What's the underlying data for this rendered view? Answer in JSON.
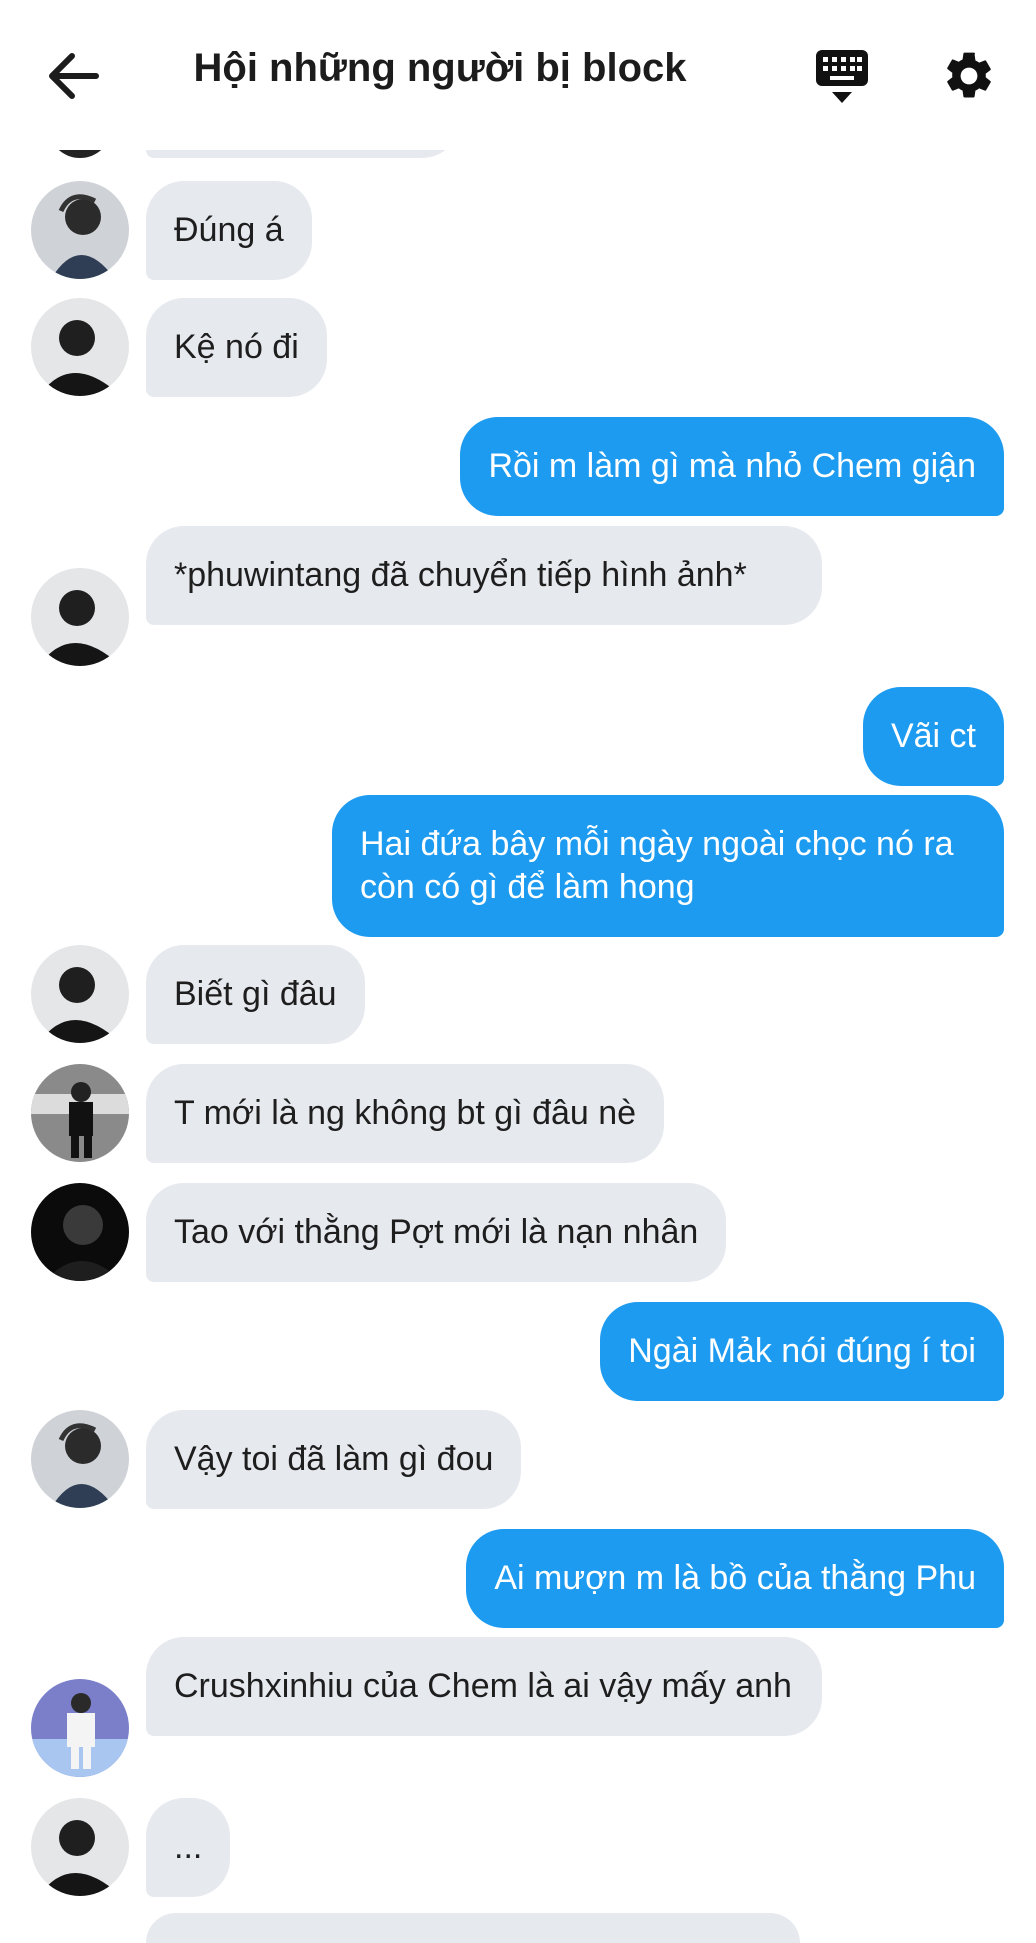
{
  "header": {
    "title": "Hội những người bị block",
    "back_icon": "arrow-left-icon",
    "keyboard_icon": "keyboard-icon",
    "settings_icon": "gear-icon"
  },
  "colors": {
    "outgoing_bubble": "#1d9bf0",
    "incoming_bubble": "#e6e9ee",
    "background": "#ffffff"
  },
  "messages": [
    {
      "side": "in",
      "text": "Đúng á"
    },
    {
      "side": "in",
      "text": "Kệ nó đi"
    },
    {
      "side": "out",
      "text": "Rồi m làm gì mà nhỏ Chem giận"
    },
    {
      "side": "in",
      "text": "*phuwintang đã chuyển tiếp hình ảnh*"
    },
    {
      "side": "out",
      "text": "Vãi ct"
    },
    {
      "side": "out",
      "text": "Hai đứa bây mỗi ngày ngoài chọc nó ra còn có gì để làm hong"
    },
    {
      "side": "in",
      "text": "Biết gì đâu"
    },
    {
      "side": "in",
      "text": "T mới là ng không bt gì đâu nè"
    },
    {
      "side": "in",
      "text": "Tao với thằng Pợt mới là nạn nhân"
    },
    {
      "side": "out",
      "text": "Ngài Mảk nói đúng í toi"
    },
    {
      "side": "in",
      "text": "Vậy toi đã làm gì đou"
    },
    {
      "side": "out",
      "text": "Ai mượn m là bồ của thằng Phu"
    },
    {
      "side": "in",
      "text": "Crushxinhiu của Chem là ai vậy mấy anh"
    },
    {
      "side": "in",
      "text": "..."
    }
  ]
}
